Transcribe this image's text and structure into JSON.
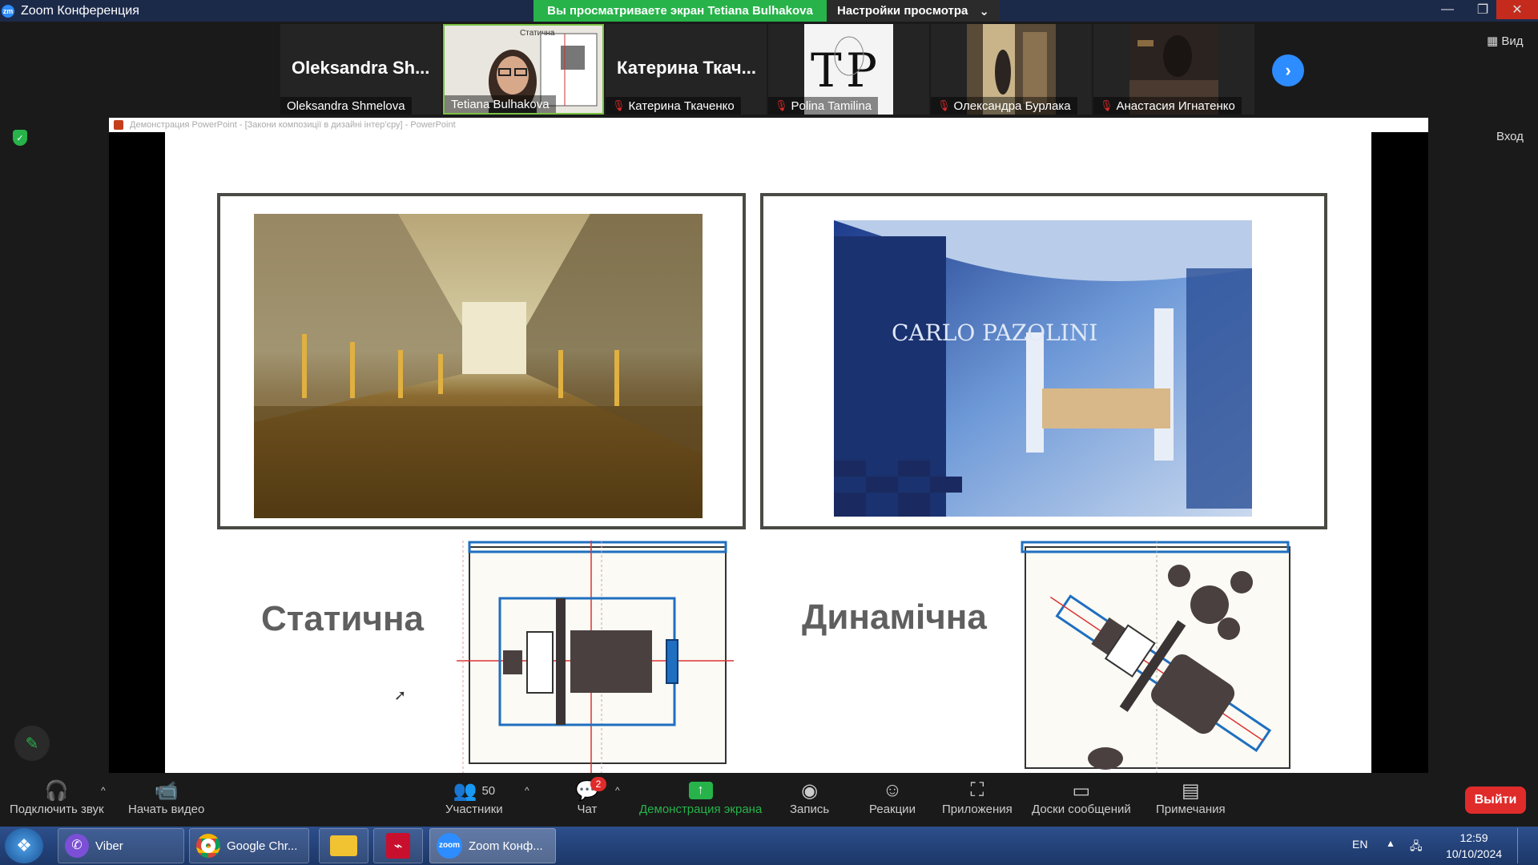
{
  "window": {
    "title": "Zoom Конференция"
  },
  "share_banner": "Вы просматриваете экран Tetiana Bulhakova",
  "view_options": {
    "label": "Настройки просмотра"
  },
  "gallery": {
    "tiles": [
      {
        "display_name": "Oleksandra Sh...",
        "caption": "Oleksandra Shmelova",
        "muted": false
      },
      {
        "display_name": "",
        "caption": "Tetiana Bulhakova",
        "muted": false,
        "video_label": "Статична"
      },
      {
        "display_name": "Катерина Ткач...",
        "caption": "Катерина Ткаченко",
        "muted": true
      },
      {
        "display_name": "",
        "caption": "Polina Tamilina",
        "muted": true
      },
      {
        "display_name": "",
        "caption": "Олександра Бурлака",
        "muted": true
      },
      {
        "display_name": "",
        "caption": "Анастасия Игнатенко",
        "muted": true
      }
    ]
  },
  "side": {
    "view_label": "Вид",
    "enter_label": "Вход"
  },
  "shared_window": {
    "title": "Демонстрация PowerPoint - [Закони композиції в дизайні інтер'єру] - PowerPoint"
  },
  "slide": {
    "label_static": "Статична",
    "label_dynamic": "Динамічна",
    "photo_sign": "CARLO PAZOLINI"
  },
  "toolbar": {
    "audio": "Подключить звук",
    "video": "Начать видео",
    "participants": "Участники",
    "participants_count": "50",
    "chat": "Чат",
    "chat_badge": "2",
    "share": "Демонстрация экрана",
    "record": "Запись",
    "reactions": "Реакции",
    "apps": "Приложения",
    "whiteboards": "Доски сообщений",
    "notes": "Примечания",
    "leave": "Выйти"
  },
  "taskbar": {
    "items": [
      "Viber",
      "Google Chr...",
      "Zoom Конф..."
    ],
    "lang": "EN",
    "time": "12:59",
    "date": "10/10/2024"
  },
  "colors": {
    "share_green": "#27b34a",
    "leave_red": "#e02b2b",
    "zoom_blue": "#2d8cff",
    "diagram_blue": "#1f6fc0"
  }
}
